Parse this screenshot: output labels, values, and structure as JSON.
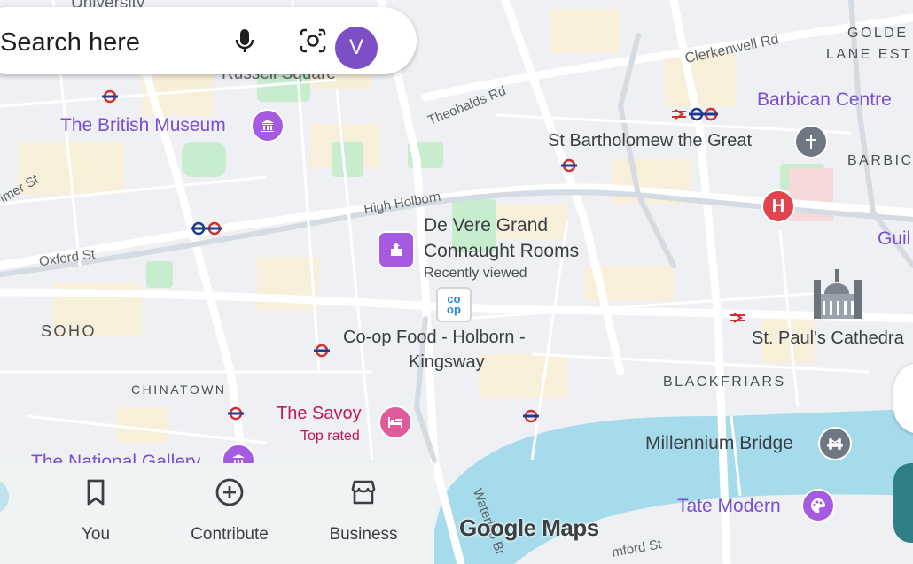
{
  "search": {
    "placeholder": "Search here",
    "avatar_letter": "V"
  },
  "map": {
    "roads": {
      "clerkenwell": "Clerkenwell Rd",
      "theobalds": "Theobalds Rd",
      "high_holborn": "High Holborn",
      "oxford": "Oxford St",
      "mortimer": "imer St",
      "waterloo": "Waterloo Br",
      "stamford": "mford St",
      "russell_square": "Russell Square",
      "university": "University"
    },
    "areas": {
      "golden_lane": [
        "GOLDE",
        "LANE EST"
      ],
      "barbican": "BARBIC",
      "soho": "SOHO",
      "chinatown": "CHINATOWN",
      "blackfriars": "BLACKFRIARS"
    },
    "places": {
      "british_museum": "The British Museum",
      "barbican_centre": "Barbican Centre",
      "st_bartholomew": "St Bartholomew the Great",
      "de_vere": "De Vere Grand",
      "de_vere_2": "Connaught Rooms",
      "recently_viewed": "Recently viewed",
      "coop": "Co-op Food - Holborn -",
      "coop_2": "Kingsway",
      "savoy": "The Savoy",
      "top_rated": "Top rated",
      "st_pauls": "St. Paul's Cathedra",
      "guild": "Guil",
      "millennium": "Millennium Bridge",
      "tate": "Tate Modern",
      "national_gallery": "The National Gallery",
      "coop_logo_1": "co",
      "coop_logo_2": "op"
    }
  },
  "bottom_nav": {
    "you": "You",
    "contribute": "Contribute",
    "business": "Business"
  },
  "branding": {
    "logo": "Google Maps"
  },
  "colors": {
    "water": "#a6dbeb",
    "park": "#c7ecce",
    "accent_purple": "#a55ae0",
    "hospital": "#e1444c",
    "search_bg": "#ffffff"
  }
}
